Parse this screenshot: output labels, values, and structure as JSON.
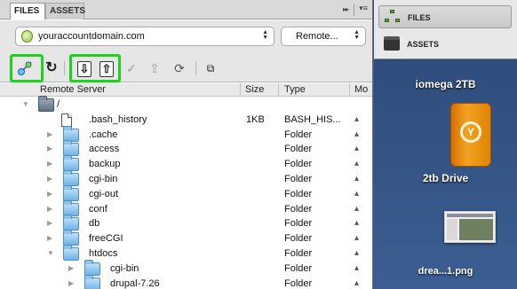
{
  "tabs": {
    "files": "FILES",
    "assets": "ASSETS",
    "collapse": "▸▸",
    "menu": "▾≡"
  },
  "site_select": {
    "value": "youraccountdomain.com"
  },
  "view_select": {
    "value": "Remote..."
  },
  "toolbar": {
    "connect": "connect-icon",
    "refresh": "↻",
    "get": "⇩",
    "put": "⇧",
    "checkout": "✓",
    "checkin": "⇪",
    "sync": "⟳",
    "expand": "⧉"
  },
  "columns": {
    "name": "Remote Server",
    "size": "Size",
    "type": "Type",
    "modified": "Mo"
  },
  "tree": [
    {
      "name": "/",
      "size": "",
      "type": "",
      "mod": "",
      "kind": "root",
      "depth": 0,
      "expanded": true
    },
    {
      "name": ".bash_history",
      "size": "1KB",
      "type": "BASH_HIS...",
      "mod": "▴",
      "kind": "file",
      "depth": 1
    },
    {
      "name": ".cache",
      "size": "",
      "type": "Folder",
      "mod": "▴",
      "kind": "folder",
      "depth": 1
    },
    {
      "name": "access",
      "size": "",
      "type": "Folder",
      "mod": "▴",
      "kind": "folder",
      "depth": 1
    },
    {
      "name": "backup",
      "size": "",
      "type": "Folder",
      "mod": "▴",
      "kind": "folder",
      "depth": 1
    },
    {
      "name": "cgi-bin",
      "size": "",
      "type": "Folder",
      "mod": "▴",
      "kind": "folder",
      "depth": 1
    },
    {
      "name": "cgi-out",
      "size": "",
      "type": "Folder",
      "mod": "▴",
      "kind": "folder",
      "depth": 1
    },
    {
      "name": "conf",
      "size": "",
      "type": "Folder",
      "mod": "▴",
      "kind": "folder",
      "depth": 1
    },
    {
      "name": "db",
      "size": "",
      "type": "Folder",
      "mod": "▴",
      "kind": "folder",
      "depth": 1
    },
    {
      "name": "freeCGI",
      "size": "",
      "type": "Folder",
      "mod": "▴",
      "kind": "folder",
      "depth": 1
    },
    {
      "name": "htdocs",
      "size": "",
      "type": "Folder",
      "mod": "▴",
      "kind": "folder",
      "depth": 1,
      "expanded": true
    },
    {
      "name": "cgi-bin",
      "size": "",
      "type": "Folder",
      "mod": "▴",
      "kind": "folder",
      "depth": 2
    },
    {
      "name": "drupal-7.26",
      "size": "",
      "type": "Folder",
      "mod": "▴",
      "kind": "folder",
      "depth": 2
    }
  ],
  "right_panel": {
    "files": "FILES",
    "assets": "ASSETS"
  },
  "desktop": {
    "iomega": "iomega 2TB",
    "drive_2tb": "2tb Drive",
    "drive_logo": "Y",
    "screenshot": "drea...1.png"
  },
  "colors": {
    "highlight": "#1bd31b",
    "desktop": "#3a5a8a",
    "folder": "#6fb3e6"
  }
}
